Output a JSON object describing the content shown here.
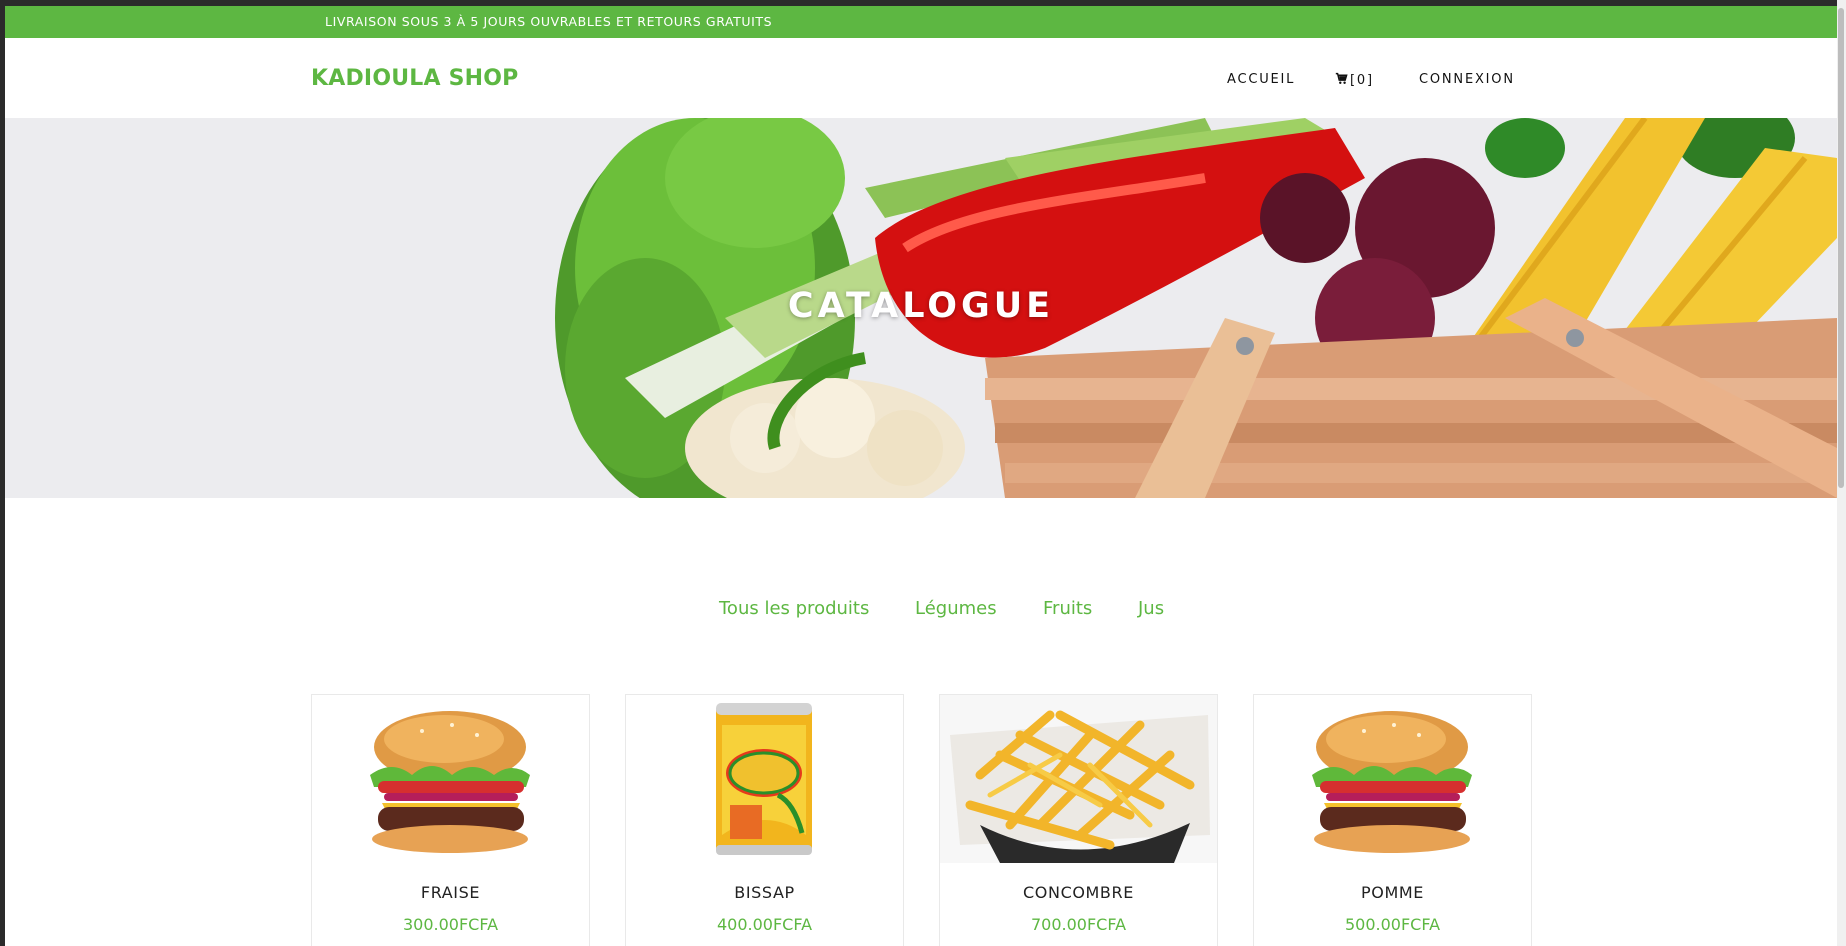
{
  "topbar": {
    "text": "LIVRAISON SOUS 3 À 5 JOURS OUVRABLES ET RETOURS GRATUITS"
  },
  "brand": "KADIOULA SHOP",
  "nav": {
    "home": "ACCUEIL",
    "cart": "[0]",
    "login": "CONNEXION"
  },
  "hero": {
    "title": "CATALOGUE"
  },
  "filters": [
    "Tous les produits",
    "Légumes",
    "Fruits",
    "Jus"
  ],
  "products": [
    {
      "name": "FRAISE",
      "price": "300.00FCFA",
      "image": "burger"
    },
    {
      "name": "BISSAP",
      "price": "400.00FCFA",
      "image": "lipton-can"
    },
    {
      "name": "CONCOMBRE",
      "price": "700.00FCFA",
      "image": "fries"
    },
    {
      "name": "POMME",
      "price": "500.00FCFA",
      "image": "burger"
    }
  ],
  "colors": {
    "accent": "#5db742",
    "text": "#222222"
  }
}
